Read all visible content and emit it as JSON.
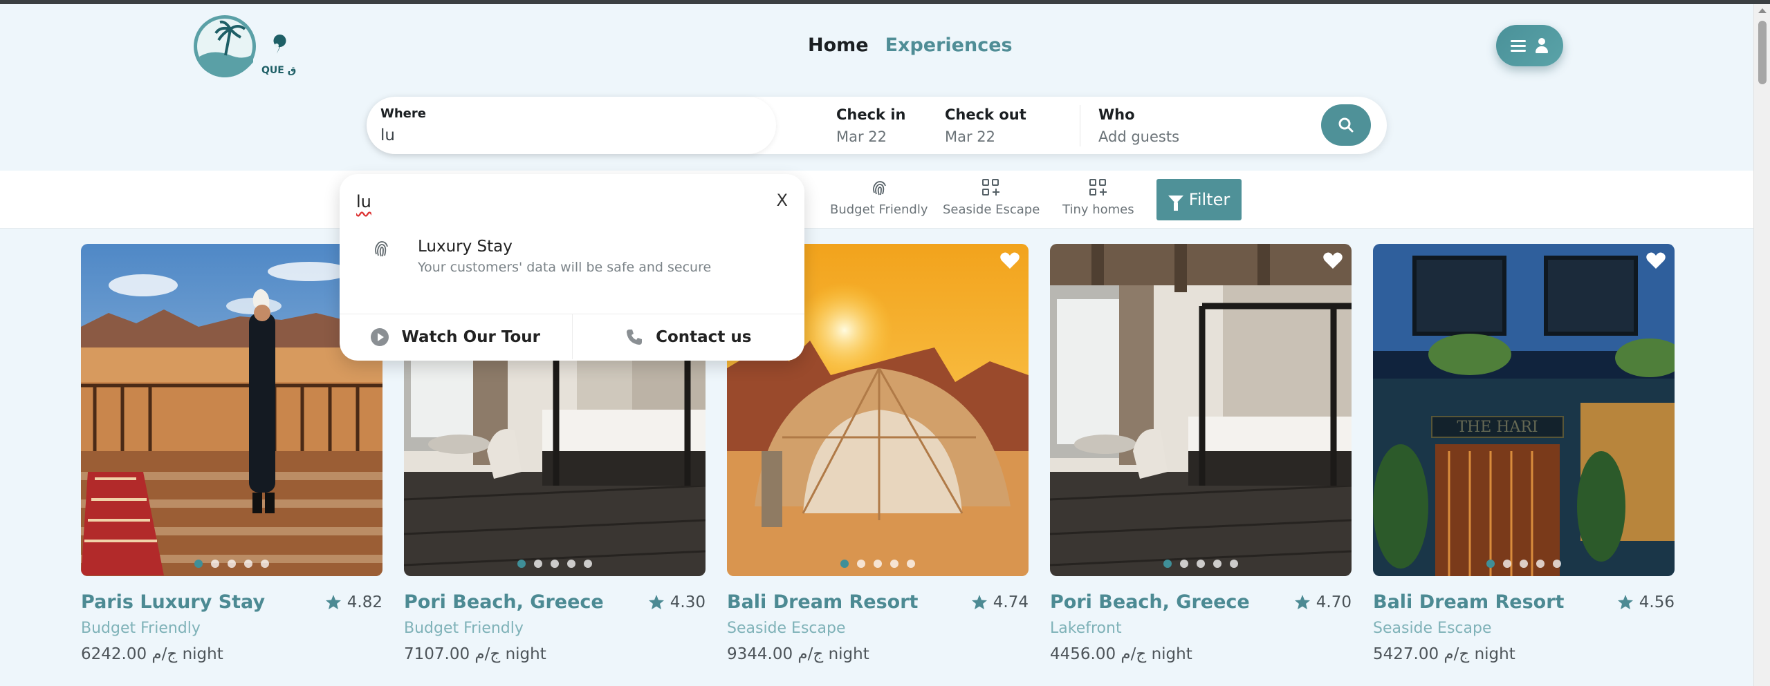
{
  "brand": {
    "logo_text": "QUE فندق"
  },
  "nav": {
    "home": "Home",
    "experiences": "Experiences"
  },
  "search": {
    "where_label": "Where",
    "where_value": "lu",
    "checkin_label": "Check in",
    "checkin_value": "Mar 22",
    "checkout_label": "Check out",
    "checkout_value": "Mar 22",
    "who_label": "Who",
    "who_placeholder": "Add guests"
  },
  "categories": [
    {
      "label": "Budget Friendly",
      "icon": "fingerprint-icon"
    },
    {
      "label": "Seaside Escape",
      "icon": "grid-plus-icon"
    },
    {
      "label": "Tiny homes",
      "icon": "grid-plus-icon"
    }
  ],
  "filter_label": "Filter",
  "dropdown": {
    "query": "lu",
    "close": "X",
    "suggestion_title": "Luxury Stay",
    "suggestion_desc": "Your customers' data will be safe and secure",
    "tour_label": "Watch Our Tour",
    "contact_label": "Contact us"
  },
  "cards": [
    {
      "title": "Paris Luxury Stay",
      "rating": "4.82",
      "category": "Budget Friendly",
      "price": "6242.00 ج/م night",
      "active_dot": 1
    },
    {
      "title": "Pori Beach, Greece",
      "rating": "4.30",
      "category": "Budget Friendly",
      "price": "7107.00 ج/م night",
      "active_dot": 1
    },
    {
      "title": "Bali Dream Resort",
      "rating": "4.74",
      "category": "Seaside Escape",
      "price": "9344.00 ج/م night",
      "active_dot": 1
    },
    {
      "title": "Pori Beach, Greece",
      "rating": "4.70",
      "category": "Lakefront",
      "price": "4456.00 ج/م night",
      "active_dot": 1
    },
    {
      "title": "Bali Dream Resort",
      "rating": "4.56",
      "category": "Seaside Escape",
      "price": "5427.00 ج/م night",
      "active_dot": 1
    }
  ],
  "colors": {
    "accent": "#4f9198",
    "title": "#4c8a93",
    "subtitle": "#7fb2b8",
    "background": "#eef6fb"
  }
}
